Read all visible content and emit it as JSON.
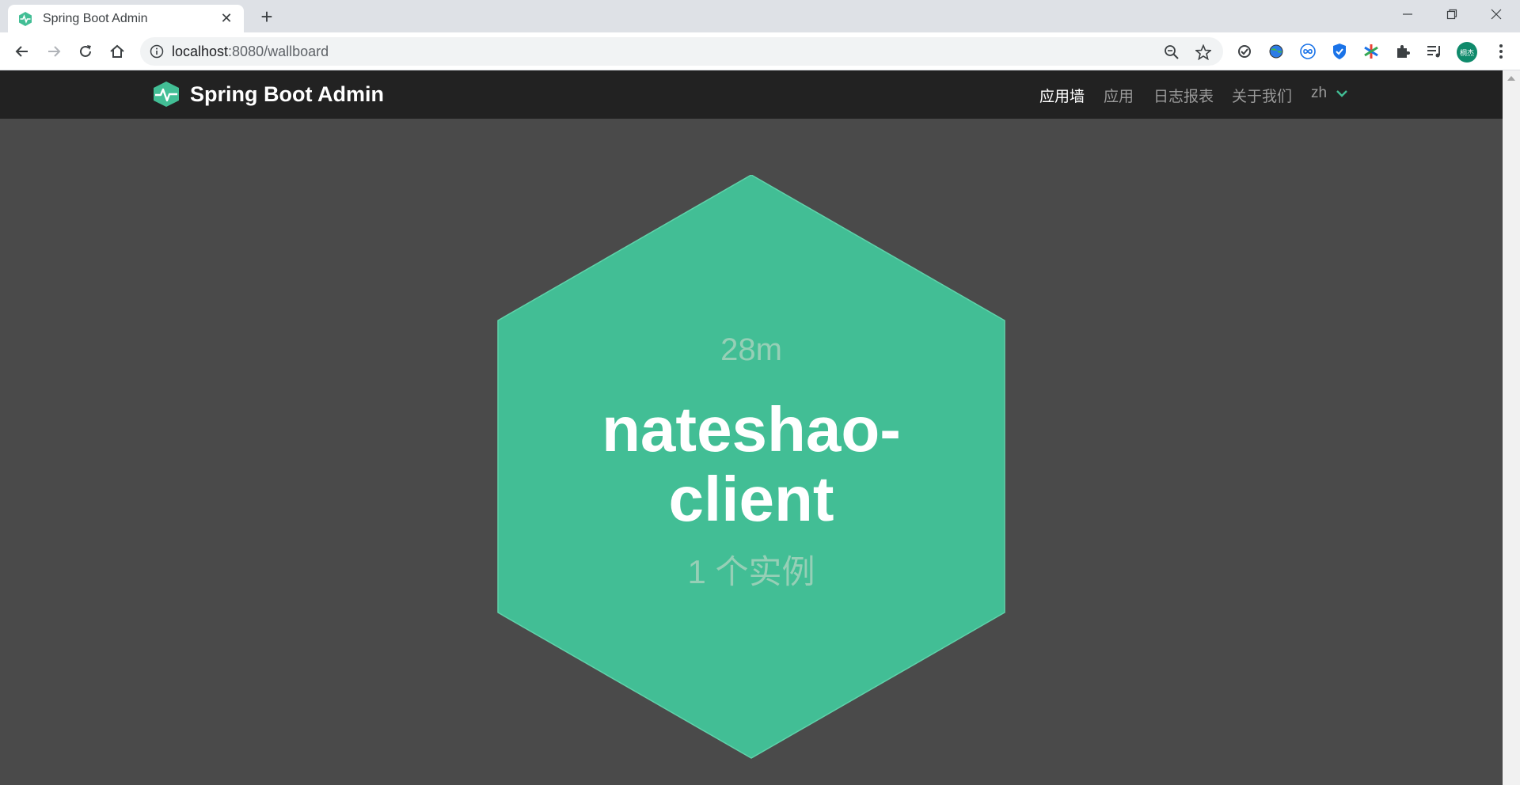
{
  "browser": {
    "tab": {
      "title": "Spring Boot Admin",
      "favicon": "spring-boot-admin-icon",
      "close": "✕"
    },
    "new_tab": "+",
    "window_controls": [
      "minimize",
      "restore",
      "close"
    ],
    "address": {
      "host": "localhost",
      "rest": ":8080/wallboard"
    },
    "profile_initials": "桐杰"
  },
  "app": {
    "brand": "Spring Boot Admin",
    "nav": {
      "wallboard": "应用墙",
      "applications": "应用",
      "journal": "日志报表",
      "about": "关于我们",
      "language": "zh"
    },
    "accent_color": "#42be95"
  },
  "wallboard": {
    "applications": [
      {
        "uptime": "28m",
        "name": "nateshao-client",
        "instances": "1 个实例",
        "status_color": "#42be95"
      }
    ]
  }
}
